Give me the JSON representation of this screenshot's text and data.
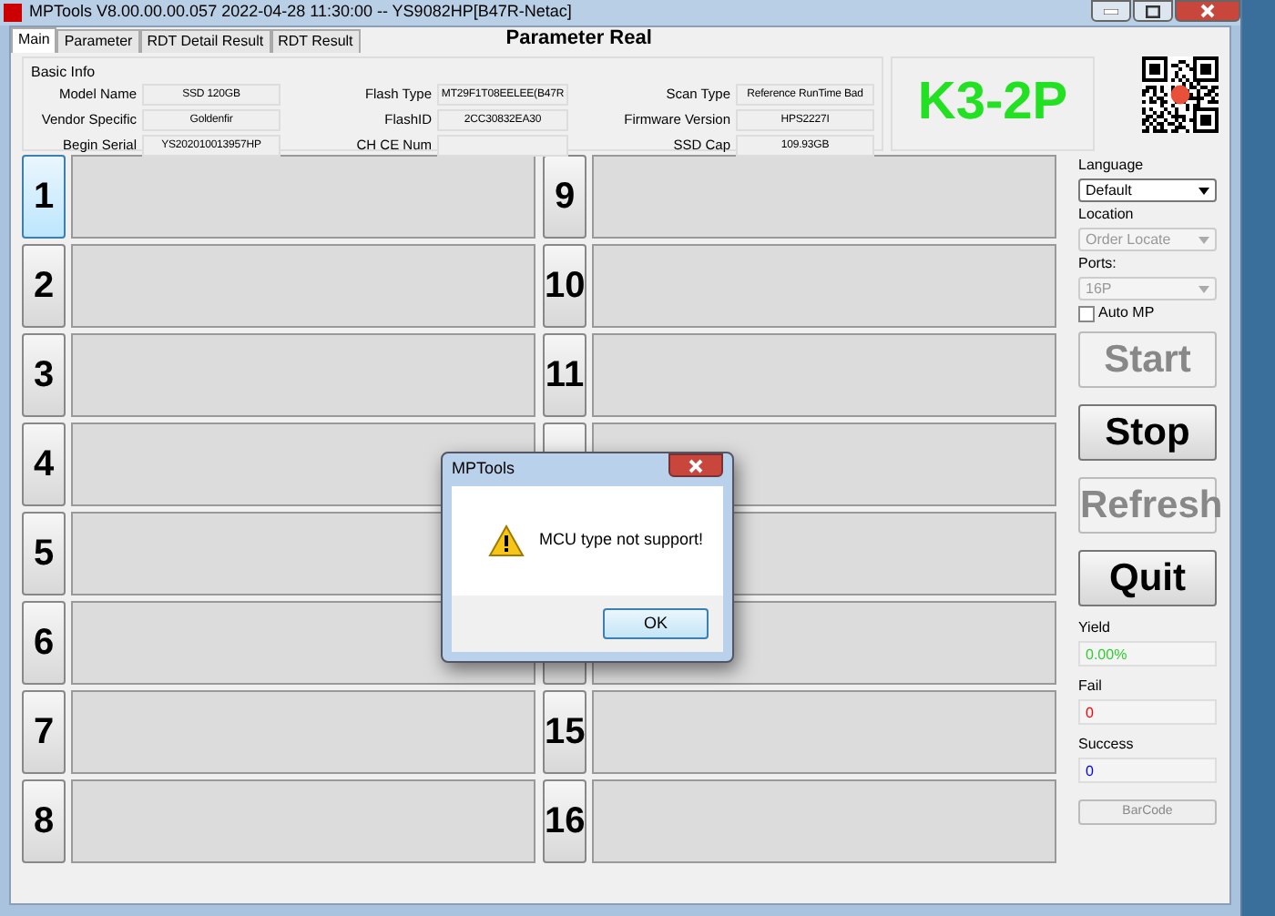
{
  "window": {
    "title": "MPTools V8.00.00.00.057 2022-04-28 11:30:00  -- YS9082HP[B47R-Netac]"
  },
  "tabs": [
    {
      "label": "Main",
      "selected": true
    },
    {
      "label": "Parameter",
      "selected": false
    },
    {
      "label": "RDT Detail Result",
      "selected": false
    },
    {
      "label": "RDT Result",
      "selected": false
    }
  ],
  "header_title": "Parameter  Real",
  "basic_info": {
    "title": "Basic Info",
    "fields": [
      {
        "label": "Model Name",
        "value": "SSD 120GB"
      },
      {
        "label": "Flash Type",
        "value": "MT29F1T08EELEE(B47R"
      },
      {
        "label": "Scan Type",
        "value": "Reference RunTime Bad"
      },
      {
        "label": "Vendor Specific",
        "value": "Goldenfir"
      },
      {
        "label": "FlashID",
        "value": "2CC30832EA30"
      },
      {
        "label": "Firmware Version",
        "value": "HPS2227I"
      },
      {
        "label": "Begin Serial",
        "value": "YS202010013957HP"
      },
      {
        "label": "CH CE Num"
      },
      {
        "label": "SSD Cap",
        "value": "109.93GB"
      }
    ]
  },
  "model_badge": "K3-2P",
  "ports_left": [
    {
      "label": "1",
      "selected": true
    },
    {
      "label": "2",
      "selected": false
    },
    {
      "label": "3",
      "selected": false
    },
    {
      "label": "4",
      "selected": false
    },
    {
      "label": "5",
      "selected": false
    },
    {
      "label": "6",
      "selected": false
    },
    {
      "label": "7",
      "selected": false
    },
    {
      "label": "8",
      "selected": false
    }
  ],
  "ports_right": [
    {
      "kind": "port",
      "label": "9",
      "selected": false
    },
    {
      "kind": "port",
      "label": "10",
      "selected": false
    },
    {
      "kind": "port",
      "label": "11",
      "selected": false
    },
    {
      "kind": "port",
      "selected": false
    },
    {
      "kind": "covered"
    },
    {
      "kind": "port",
      "selected": false
    },
    {
      "kind": "port",
      "label": "15",
      "selected": false
    },
    {
      "kind": "port",
      "label": "16",
      "selected": false
    }
  ],
  "sidebar": {
    "selects": [
      {
        "label": "Language",
        "value": "Default",
        "disabled": false
      },
      {
        "label": "Location",
        "value": "Order Locate",
        "disabled": true
      },
      {
        "label": "Ports:",
        "value": "16P",
        "disabled": true
      }
    ],
    "auto_mp": {
      "label": "Auto MP",
      "checked": false
    },
    "buttons": [
      {
        "label": "Start",
        "disabled": true
      },
      {
        "label": "Stop",
        "disabled": false
      },
      {
        "label": "Refresh",
        "disabled": true
      },
      {
        "label": "Quit",
        "disabled": false
      }
    ],
    "stats": [
      {
        "label": "Yield",
        "value": "0.00%",
        "color": "#33cc33"
      },
      {
        "label": "Fail",
        "value": "0",
        "color": "#ff0000"
      },
      {
        "label": "Success",
        "value": "0",
        "color": "#0000ff"
      }
    ],
    "barcode": {
      "label": "BarCode",
      "disabled": true
    }
  },
  "dialog": {
    "title": "MPTools",
    "message": "MCU type not support!",
    "button": "OK"
  }
}
